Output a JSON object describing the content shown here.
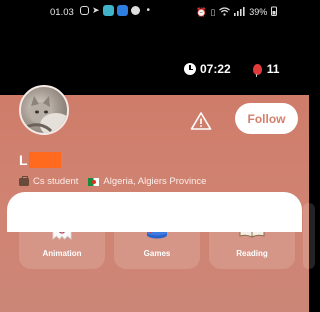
{
  "status_bar": {
    "time": "01.03",
    "battery": "39%"
  },
  "counters": {
    "time_left": "07:22",
    "balloons": "11"
  },
  "profile": {
    "username_visible": "L",
    "occupation": "Cs student",
    "location": "Algeria, Algiers Province",
    "follow_label": "Follow"
  },
  "interests": [
    {
      "label": "Animation",
      "icon": "ghost-icon"
    },
    {
      "label": "Games",
      "icon": "joystick-icon"
    },
    {
      "label": "Reading",
      "icon": "book-icon"
    }
  ],
  "colors": {
    "profile_bg": "#cf7c6a",
    "follow_text": "#d4806c",
    "redaction": "#ff6a1f"
  }
}
